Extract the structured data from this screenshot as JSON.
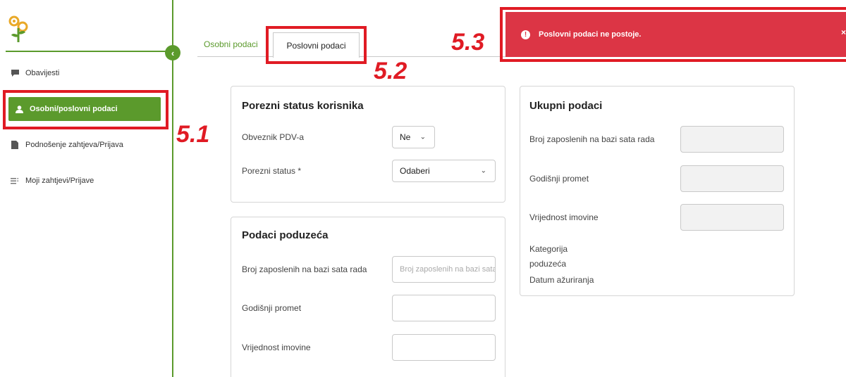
{
  "sidebar": {
    "items": [
      {
        "label": "Obavijesti",
        "icon": "chat-icon"
      },
      {
        "label": "Osobni/poslovni podaci",
        "icon": "user-icon"
      },
      {
        "label": "Podnošenje zahtjeva/Prijava",
        "icon": "document-icon"
      },
      {
        "label": "Moji zahtjevi/Prijave",
        "icon": "list-icon"
      }
    ]
  },
  "annotations": {
    "a1": "5.1",
    "a2": "5.2",
    "a3": "5.3"
  },
  "tabs": {
    "osobni": "Osobni podaci",
    "poslovni": "Poslovni podaci"
  },
  "alert": {
    "message": "Poslovni podaci ne postoje.",
    "close": "×"
  },
  "porezni": {
    "title": "Porezni status korisnika",
    "pdv_label": "Obveznik PDV-a",
    "pdv_value": "Ne",
    "status_label": "Porezni status *",
    "status_value": "Odaberi"
  },
  "poduzece": {
    "title": "Podaci poduzeća",
    "zaposleni_label": "Broj zaposlenih na bazi sata rada",
    "zaposleni_placeholder": "Broj zaposlenih na bazi sata rada",
    "promet_label": "Godišnji promet",
    "imovina_label": "Vrijednost imovine"
  },
  "ukupni": {
    "title": "Ukupni podaci",
    "zaposleni_label": "Broj zaposlenih na bazi sata rada",
    "promet_label": "Godišnji promet",
    "imovina_label": "Vrijednost imovine",
    "kategorija_line1": "Kategorija",
    "kategorija_line2": "poduzeća",
    "datum_label": "Datum ažuriranja"
  },
  "colors": {
    "brand": "#5b9a2c",
    "alert": "#dc3545",
    "annotation": "#e01b24"
  }
}
